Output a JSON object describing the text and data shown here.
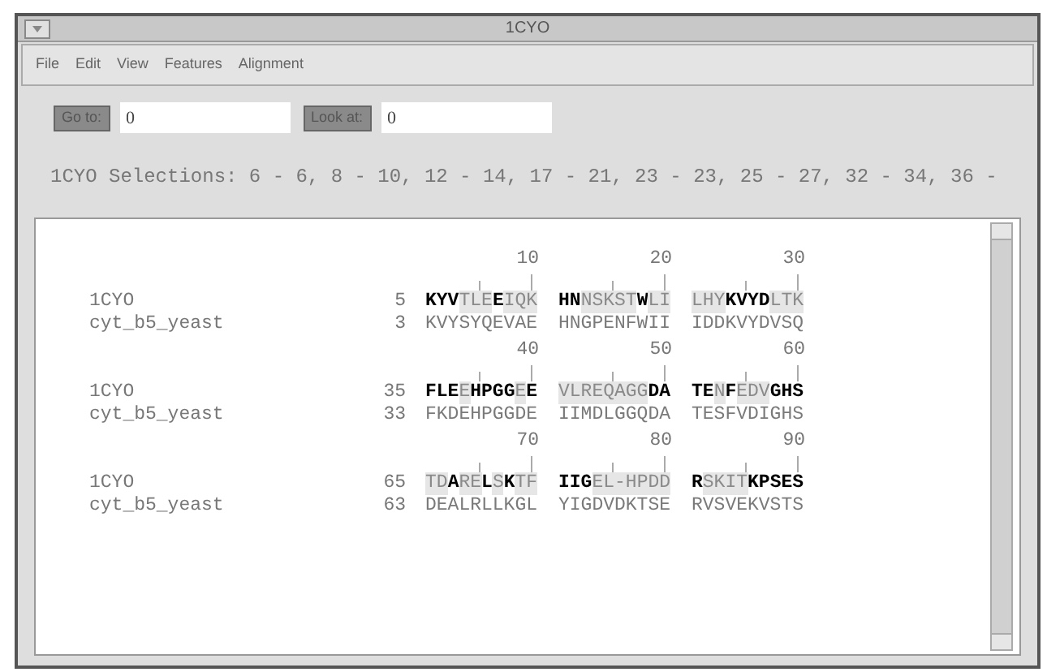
{
  "window": {
    "title": "1CYO"
  },
  "menu": [
    "File",
    "Edit",
    "View",
    "Features",
    "Alignment"
  ],
  "toolbar": [
    {
      "button": "Go to:",
      "value": "0"
    },
    {
      "button": "Look at:",
      "value": "0"
    }
  ],
  "selections": "1CYO Selections: 6 - 6, 8 - 10, 12 - 14, 17 - 21, 23 - 23, 25 - 27, 32 - 34, 36 -",
  "blocks": [
    {
      "ruler": [
        "10",
        "20",
        "30"
      ],
      "rows": [
        {
          "name": "1CYO",
          "start": "5",
          "groups": [
            [
              {
                "text": "KYV",
                "kind": "bold"
              },
              {
                "text": "TLE",
                "kind": "shaded"
              },
              {
                "text": "E",
                "kind": "bold"
              },
              {
                "text": "IQK",
                "kind": "shaded"
              }
            ],
            [
              {
                "text": "HN",
                "kind": "bold"
              },
              {
                "text": "NSKST",
                "kind": "shaded"
              },
              {
                "text": "W",
                "kind": "bold"
              },
              {
                "text": "LI",
                "kind": "shaded"
              }
            ],
            [
              {
                "text": "LHY",
                "kind": "shaded"
              },
              {
                "text": "KVYD",
                "kind": "bold"
              },
              {
                "text": "LTK",
                "kind": "shaded"
              }
            ]
          ]
        },
        {
          "name": "cyt_b5_yeast",
          "start": "3",
          "groups": [
            [
              {
                "text": "KVYSYQEVAE",
                "kind": "plain"
              }
            ],
            [
              {
                "text": "HNGPENFWII",
                "kind": "plain"
              }
            ],
            [
              {
                "text": "IDDKVYDVSQ",
                "kind": "plain"
              }
            ]
          ]
        }
      ]
    },
    {
      "ruler": [
        "40",
        "50",
        "60"
      ],
      "rows": [
        {
          "name": "1CYO",
          "start": "35",
          "groups": [
            [
              {
                "text": "FLE",
                "kind": "bold"
              },
              {
                "text": "E",
                "kind": "shaded"
              },
              {
                "text": "HPGG",
                "kind": "bold"
              },
              {
                "text": "E",
                "kind": "shaded"
              },
              {
                "text": "E",
                "kind": "bold"
              }
            ],
            [
              {
                "text": "VLREQAGG",
                "kind": "shaded"
              },
              {
                "text": "DA",
                "kind": "bold"
              }
            ],
            [
              {
                "text": "TE",
                "kind": "bold"
              },
              {
                "text": "N",
                "kind": "shaded"
              },
              {
                "text": "F",
                "kind": "bold"
              },
              {
                "text": "EDV",
                "kind": "shaded"
              },
              {
                "text": "GHS",
                "kind": "bold"
              }
            ]
          ]
        },
        {
          "name": "cyt_b5_yeast",
          "start": "33",
          "groups": [
            [
              {
                "text": "FKDEHPGGDE",
                "kind": "plain"
              }
            ],
            [
              {
                "text": "IIMDLGGQDA",
                "kind": "plain"
              }
            ],
            [
              {
                "text": "TESFVDIGHS",
                "kind": "plain"
              }
            ]
          ]
        }
      ]
    },
    {
      "ruler": [
        "70",
        "80",
        "90"
      ],
      "rows": [
        {
          "name": "1CYO",
          "start": "65",
          "groups": [
            [
              {
                "text": "TD",
                "kind": "shaded"
              },
              {
                "text": "A",
                "kind": "bold"
              },
              {
                "text": "RE",
                "kind": "shaded"
              },
              {
                "text": "L",
                "kind": "bold"
              },
              {
                "text": "S",
                "kind": "shaded"
              },
              {
                "text": "K",
                "kind": "bold"
              },
              {
                "text": "TF",
                "kind": "shaded"
              }
            ],
            [
              {
                "text": "IIG",
                "kind": "bold"
              },
              {
                "text": "EL-HPDD",
                "kind": "shaded"
              }
            ],
            [
              {
                "text": "R",
                "kind": "bold"
              },
              {
                "text": "SKIT",
                "kind": "shaded"
              },
              {
                "text": "KPSES",
                "kind": "bold"
              }
            ]
          ]
        },
        {
          "name": "cyt_b5_yeast",
          "start": "63",
          "groups": [
            [
              {
                "text": "DEALRLLKGL",
                "kind": "plain"
              }
            ],
            [
              {
                "text": "YIGDVDKTSE",
                "kind": "plain"
              }
            ],
            [
              {
                "text": "RVSVEKVSTS",
                "kind": "plain"
              }
            ]
          ]
        }
      ]
    }
  ]
}
